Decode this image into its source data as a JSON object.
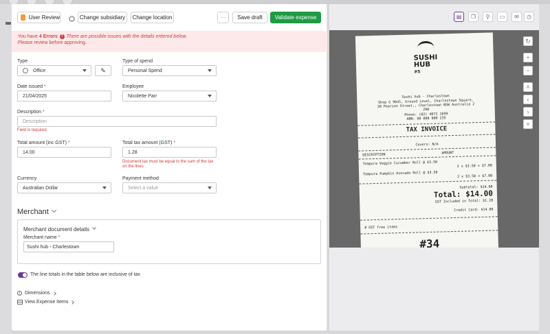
{
  "toolbar": {
    "status_label": "User Review",
    "change_subsidiary": "Change subsidiary",
    "change_location": "Change location",
    "more_label": "···",
    "save_draft": "Save draft",
    "validate": "Validate expense",
    "status_color": "#f39a3b",
    "validate_color": "#1e9b45"
  },
  "banner": {
    "prefix": "You have ",
    "count": "4 Errors",
    "message": "There are possible issues with the details entered below.",
    "line2": "Please review before approving.",
    "color": "#d23b3b"
  },
  "form": {
    "type": {
      "label": "Type",
      "value": "Office"
    },
    "type_of_spend": {
      "label": "Type of spend",
      "value": "Personal Spend"
    },
    "date_issued": {
      "label": "Date issued",
      "value": "21/04/2025"
    },
    "employee": {
      "label": "Employee",
      "value": "Nicolette Parr"
    },
    "description": {
      "label": "Description",
      "placeholder": "Description",
      "error": "Field is required"
    },
    "total_amount": {
      "label": "Total amount (inc GST)",
      "value": "14.00"
    },
    "total_tax": {
      "label": "Total tax amount (GST)",
      "value": "1.28",
      "error_line1": "Document tax must be equal to the sum of the tax",
      "error_line2": "on the lines"
    },
    "currency": {
      "label": "Currency",
      "value": "Australian Dollar"
    },
    "payment_method": {
      "label": "Payment method",
      "placeholder": "Select a value"
    },
    "required_marker": "*"
  },
  "merchant": {
    "section_title": "Merchant",
    "box_title": "Merchant document details",
    "name_label": "Merchant name",
    "name_value": "Sushi hub - Charlestown"
  },
  "toggle_label": "The line totals in the table below are inclusive of tax",
  "links": {
    "dimensions": "Dimensions",
    "view_items": "View Expense Items"
  },
  "viewer": {
    "tool_icons": [
      "document-icon",
      "copy-icon",
      "pin-icon",
      "comment-icon",
      "mail-icon",
      "history-icon"
    ],
    "controls": [
      "refresh-icon",
      "zoom-in-icon",
      "zoom-out-icon",
      "chevron-up-icon",
      "chevron-left-icon",
      "chevron-right-icon",
      "chevron-down-icon"
    ]
  },
  "receipt": {
    "brand_line1": "SUSHI",
    "brand_line2": "HUB",
    "store_num": "#5",
    "store": "Sushi hub - Charlestown",
    "addr1": "Shop G 9041, Ground Level, Charlestown Square,",
    "addr2": "30 Pearson Street,, Charlestown  NSW Australia 2",
    "addr3": "290",
    "phone": "Phone: (02) 4072 1699",
    "abn": "ABN:  80 088 000 235",
    "heading": "TAX INVOICE",
    "covers": "Covers: N/A",
    "col_desc": "DESCRIPTION",
    "col_amount": "AMOUNT",
    "item1": "Tempura Veggie Cucumber Roll @ $3.50",
    "item1_qty": "2 x    $3.50 = $7.00",
    "item2": "Tempura Pumpkin Avocado Roll @ $3.50",
    "item2_qty": "2 x    $3.50 = $7.00",
    "subtotal": "Subtotal: $14.00",
    "total": "Total: $14.00",
    "gst": "GST Included in Total: $1.28",
    "card": "Credit Card: $14.00",
    "gst_free": "# GST free items",
    "order_num": "#34"
  }
}
